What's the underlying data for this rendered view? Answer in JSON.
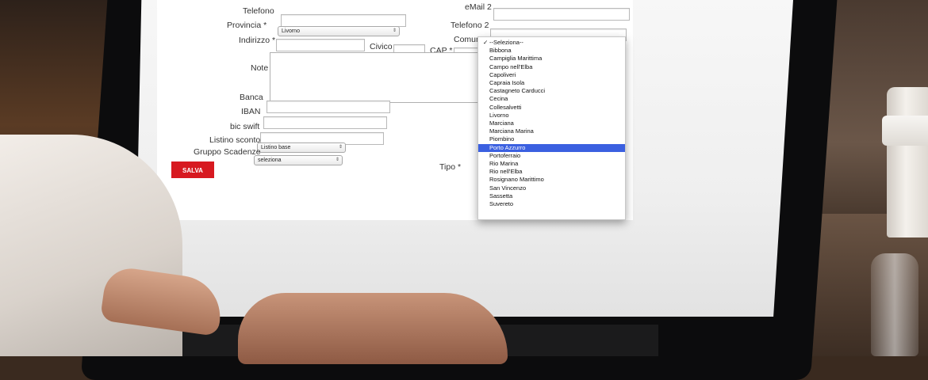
{
  "form": {
    "labels": {
      "telefono": "Telefono",
      "provincia": "Provincia *",
      "indirizzo": "Indirizzo *",
      "civico": "Civico",
      "cap": "CAP *",
      "note": "Note",
      "banca": "Banca",
      "iban": "IBAN",
      "bic": "bic swift",
      "listino": "Listino sconto",
      "gruppo": "Gruppo Scadenze",
      "email2": "eMail 2",
      "telefono2": "Telefono 2",
      "comune": "Comune",
      "tipo": "Tipo *"
    },
    "provincia_value": "Livorno",
    "listino_value": "Listino base",
    "gruppo_value": "seleziona",
    "save_label": "SALVA"
  },
  "comune_dropdown": {
    "check_mark": "✓",
    "options": [
      "--Seleziona--",
      "Bibbona",
      "Campiglia Marittima",
      "Campo nell'Elba",
      "Capoliveri",
      "Capraia Isola",
      "Castagneto Carducci",
      "Cecina",
      "Collesalvetti",
      "Livorno",
      "Marciana",
      "Marciana Marina",
      "Piombino",
      "Porto Azzurro",
      "Portoferraio",
      "Rio Marina",
      "Rio nell'Elba",
      "Rosignano Marittimo",
      "San Vincenzo",
      "Sassetta",
      "Suvereto"
    ],
    "highlighted": "Porto Azzurro",
    "highlight_color": "#3b60e0"
  },
  "colors": {
    "save_button": "#d71920"
  }
}
